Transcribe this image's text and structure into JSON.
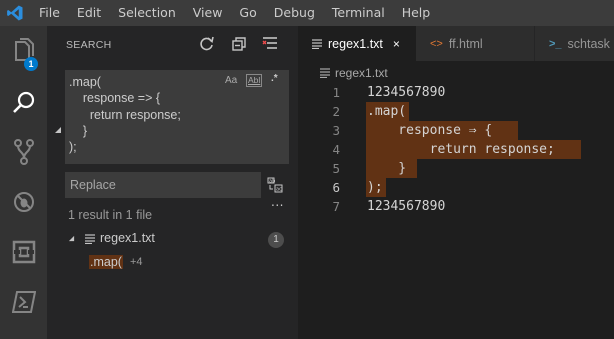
{
  "menu": [
    "File",
    "Edit",
    "Selection",
    "View",
    "Go",
    "Debug",
    "Terminal",
    "Help"
  ],
  "activity": {
    "explorer_badge": "1"
  },
  "sidebar": {
    "title": "SEARCH",
    "search_lines": [
      ".map(",
      "    response => {",
      "      return response;",
      "    }",
      ");"
    ],
    "options": {
      "match_case": "Aa",
      "whole_word": "Abl",
      "regex": ".*"
    },
    "replace_placeholder": "Replace",
    "more": "...",
    "summary": "1 result in 1 file",
    "results": [
      {
        "file": "regex1.txt",
        "count": "1",
        "match": ".map(",
        "more": "+4"
      }
    ]
  },
  "tabs": [
    {
      "label": "regex1.txt",
      "icon": "text-file-icon",
      "active": true,
      "close": "×"
    },
    {
      "label": "ff.html",
      "icon": "code-brackets-icon",
      "active": false
    },
    {
      "label": "schtask",
      "icon": "terminal-prompt-icon",
      "active": false
    }
  ],
  "breadcrumb": "regex1.txt",
  "editor": {
    "current_line": 6,
    "lines": [
      {
        "n": "1",
        "text": "1234567890"
      },
      {
        "n": "2",
        "text": ".map("
      },
      {
        "n": "3",
        "text": "    response ⇒ {"
      },
      {
        "n": "4",
        "text": "        return response;"
      },
      {
        "n": "5",
        "text": "    }"
      },
      {
        "n": "6",
        "text": ");"
      },
      {
        "n": "7",
        "text": "1234567890"
      }
    ]
  },
  "colors": {
    "find_match_highlight": "#613214",
    "accent": "#007acc"
  }
}
